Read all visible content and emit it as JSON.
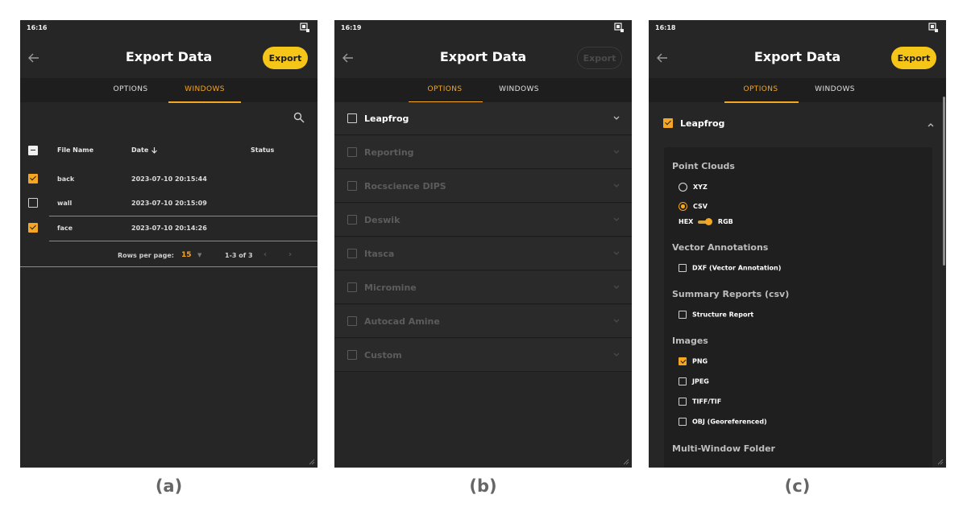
{
  "captions": [
    "(a)",
    "(b)",
    "(c)"
  ],
  "screen_a": {
    "time": "16:16",
    "title": "Export Data",
    "export_label": "Export",
    "tabs": [
      "OPTIONS",
      "WINDOWS"
    ],
    "active_tab": "WINDOWS",
    "table": {
      "headers": {
        "file_name": "File Name",
        "date": "Date",
        "status": "Status"
      },
      "header_checkbox": "indeterminate",
      "rows": [
        {
          "file_name": "back",
          "date": "2023-07-10 20:15:44",
          "status": "",
          "checked": true
        },
        {
          "file_name": "wall",
          "date": "2023-07-10 20:15:09",
          "status": "",
          "checked": false
        },
        {
          "file_name": "face",
          "date": "2023-07-10 20:14:26",
          "status": "",
          "checked": true
        }
      ],
      "rows_per_page_label": "Rows per page:",
      "rows_per_page": "15",
      "range": "1-3 of 3"
    }
  },
  "screen_b": {
    "time": "16:19",
    "title": "Export Data",
    "export_label": "Export",
    "export_enabled": false,
    "tabs": [
      "OPTIONS",
      "WINDOWS"
    ],
    "active_tab": "OPTIONS",
    "items": [
      {
        "label": "Leapfrog",
        "checked": false,
        "enabled": true
      },
      {
        "label": "Reporting",
        "checked": false,
        "enabled": false
      },
      {
        "label": "Rocscience DIPS",
        "checked": false,
        "enabled": false
      },
      {
        "label": "Deswik",
        "checked": false,
        "enabled": false
      },
      {
        "label": "Itasca",
        "checked": false,
        "enabled": false
      },
      {
        "label": "Micromine",
        "checked": false,
        "enabled": false
      },
      {
        "label": "Autocad Amine",
        "checked": false,
        "enabled": false
      },
      {
        "label": "Custom",
        "checked": false,
        "enabled": false
      }
    ]
  },
  "screen_c": {
    "time": "16:18",
    "title": "Export Data",
    "export_label": "Export",
    "tabs": [
      "OPTIONS",
      "WINDOWS"
    ],
    "active_tab": "OPTIONS",
    "leapfrog": {
      "label": "Leapfrog",
      "checked": true,
      "expanded": true
    },
    "sections": {
      "point_clouds": {
        "title": "Point Clouds",
        "format_options": [
          {
            "label": "XYZ",
            "selected": false
          },
          {
            "label": "CSV",
            "selected": true
          }
        ],
        "color_toggle": {
          "left": "HEX",
          "right": "RGB",
          "value": "RGB"
        }
      },
      "vector_annotations": {
        "title": "Vector Annotations",
        "options": [
          {
            "label": "DXF (Vector Annotation)",
            "checked": false
          }
        ]
      },
      "summary_reports": {
        "title": "Summary Reports (csv)",
        "options": [
          {
            "label": "Structure Report",
            "checked": false
          }
        ]
      },
      "images": {
        "title": "Images",
        "options": [
          {
            "label": "PNG",
            "checked": true
          },
          {
            "label": "JPEG",
            "checked": false
          },
          {
            "label": "TIFF/TIF",
            "checked": false
          },
          {
            "label": "OBJ (Georeferenced)",
            "checked": false
          }
        ]
      },
      "multi_window": {
        "title": "Multi-Window Folder"
      }
    }
  },
  "colors": {
    "accent": "#f5a623",
    "export_button": "#f5c518",
    "background": "#262626",
    "tabbar": "#1e1e1e"
  }
}
